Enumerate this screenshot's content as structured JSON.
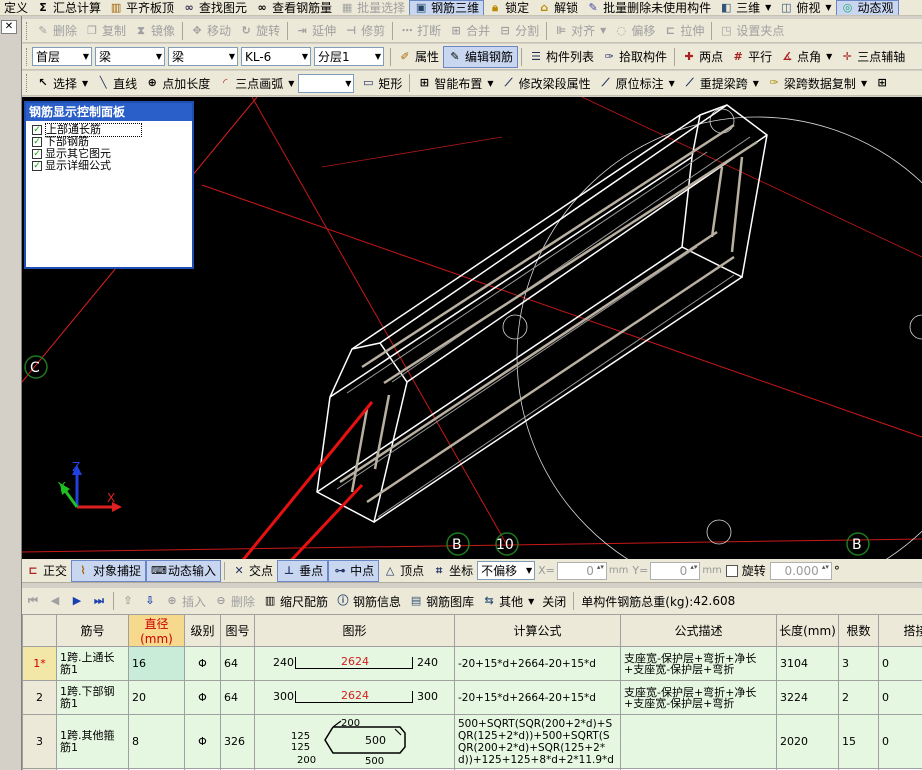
{
  "menu": {
    "items": [
      "定义",
      "汇总计算",
      "平齐板顶",
      "查找图元",
      "查看钢筋量",
      "批量选择",
      "钢筋三维",
      "锁定",
      "解锁",
      "批量删除未使用构件",
      "三维",
      "俯视",
      "动态观"
    ]
  },
  "edit_toolbar": {
    "items": [
      "删除",
      "复制",
      "镜像",
      "移动",
      "旋转",
      "延伸",
      "修剪",
      "打断",
      "合并",
      "分割",
      "对齐",
      "偏移",
      "拉伸",
      "设置夹点"
    ]
  },
  "selector_toolbar": {
    "floor": "首层",
    "category": "梁",
    "type": "梁",
    "element": "KL-6",
    "layer": "分层1",
    "buttons": [
      "属性",
      "编辑钢筋",
      "构件列表",
      "拾取构件",
      "两点",
      "平行",
      "点角",
      "三点辅轴"
    ]
  },
  "draw_toolbar": {
    "items": [
      "选择",
      "直线",
      "点加长度",
      "三点画弧",
      "矩形",
      "智能布置",
      "修改梁段属性",
      "原位标注",
      "重提梁跨",
      "梁跨数据复制"
    ]
  },
  "rebar_panel": {
    "title": "钢筋显示控制面板",
    "items": [
      {
        "label": "上部通长筋",
        "checked": true
      },
      {
        "label": "下部钢筋",
        "checked": true
      },
      {
        "label": "显示其它图元",
        "checked": true
      },
      {
        "label": "显示详细公式",
        "checked": true
      }
    ]
  },
  "viewport": {
    "axis_labels": {
      "c": "C",
      "b1": "B",
      "b1_num": "10",
      "b2": "B"
    },
    "triad": {
      "x": "X",
      "y": "Y",
      "z": "Z"
    },
    "colors": {
      "beam": "#ffffff",
      "rebar": "#b8b0a0",
      "axis": "#e02020",
      "arrow": "#e81010",
      "circle": "#d8d8d8",
      "marker": "#1f7a1f"
    }
  },
  "snap_toolbar": {
    "items": [
      "正交",
      "对象捕捉",
      "动态输入",
      "交点",
      "垂点",
      "中点",
      "顶点",
      "坐标"
    ],
    "offset": "不偏移",
    "x_label": "X=",
    "x_value": "0",
    "unit1": "mm",
    "y_label": "Y=",
    "y_value": "0",
    "unit2": "mm",
    "rotate_label": "旋转",
    "rotate_value": "0.000",
    "degree": "°"
  },
  "grid_toolbar": {
    "items": [
      "插入",
      "删除",
      "缩尺配筋",
      "钢筋信息",
      "钢筋图库",
      "其他",
      "关闭"
    ],
    "total_label": "单构件钢筋总重(kg):",
    "total_value": "42.608"
  },
  "table": {
    "headers": [
      "",
      "筋号",
      "直径(mm)",
      "级别",
      "图号",
      "图形",
      "计算公式",
      "公式描述",
      "长度(mm)",
      "根数",
      "搭接"
    ],
    "rows": [
      {
        "no": "1*",
        "name": "1跨.上通长筋1",
        "dia": "16",
        "grade": "Φ",
        "shape_no": "64",
        "shape": {
          "left": "240",
          "mid": "2624",
          "right": "240"
        },
        "formula": "-20+15*d+2664-20+15*d",
        "desc": "支座宽-保护层+弯折+净长+支座宽-保护层+弯折",
        "length": "3104",
        "count": "3",
        "lap": "0"
      },
      {
        "no": "2",
        "name": "1跨.下部钢筋1",
        "dia": "20",
        "grade": "Φ",
        "shape_no": "64",
        "shape": {
          "left": "300",
          "mid": "2624",
          "right": "300"
        },
        "formula": "-20+15*d+2664-20+15*d",
        "desc": "支座宽-保护层+弯折+净长+支座宽-保护层+弯折",
        "length": "3224",
        "count": "2",
        "lap": "0"
      },
      {
        "no": "3",
        "name": "1跨.其他箍筋1",
        "dia": "8",
        "grade": "Φ",
        "shape_no": "326",
        "shape": {
          "top": "200",
          "h1": "125",
          "h2": "125",
          "mid": "500",
          "bottom_left": "200",
          "bottom": "500"
        },
        "formula": "500+SQRT(SQR(200+2*d)+SQR(125+2*d))+500+SQRT(SQR(200+2*d)+SQR(125+2*d))+125+125+8*d+2*11.9*d",
        "desc": "",
        "length": "2020",
        "count": "15",
        "lap": "0"
      },
      {
        "no": "4",
        "name": "",
        "dia": "",
        "grade": "",
        "shape_no": "",
        "formula": "",
        "desc": "",
        "length": "",
        "count": "",
        "lap": ""
      }
    ]
  }
}
